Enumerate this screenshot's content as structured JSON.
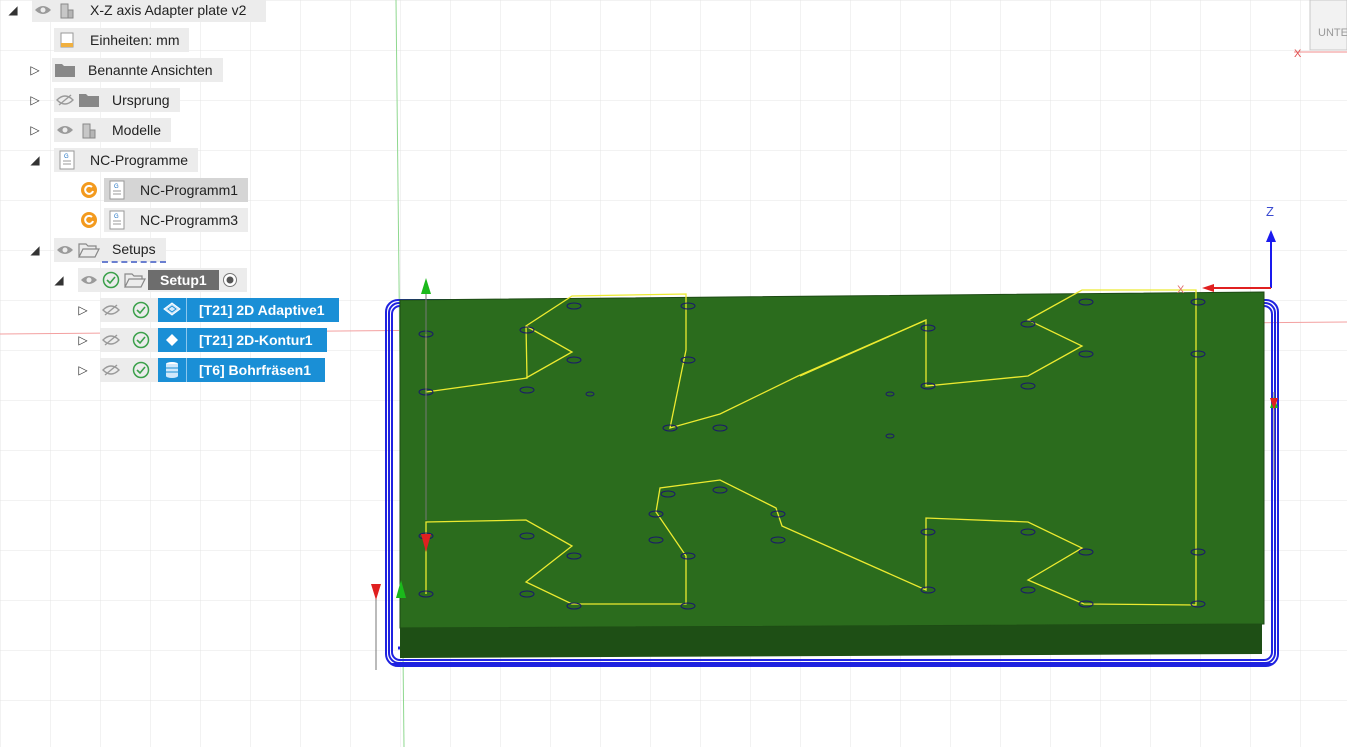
{
  "browser": {
    "root": {
      "label": "X-Z axis Adapter plate v2"
    },
    "units": {
      "label": "Einheiten: mm"
    },
    "named_views": {
      "label": "Benannte Ansichten"
    },
    "origin": {
      "label": "Ursprung"
    },
    "models": {
      "label": "Modelle"
    },
    "nc_programs": {
      "label": "NC-Programme",
      "items": [
        {
          "label": "NC-Programm1"
        },
        {
          "label": "NC-Programm3"
        }
      ]
    },
    "setups": {
      "label": "Setups",
      "setup1": {
        "label": "Setup1"
      },
      "operations": [
        {
          "label": "[T21] 2D Adaptive1"
        },
        {
          "label": "[T21] 2D-Kontur1"
        },
        {
          "label": "[T6] Bohrfräsen1"
        }
      ]
    }
  },
  "viewcube": {
    "label": "UNTE"
  },
  "axes": {
    "z": "Z",
    "x": "X"
  },
  "colors": {
    "stock_green": "#2a6b1c",
    "toolpath_blue": "#1f22e0",
    "toolpath_yellow": "#e8e62a",
    "selection_blue": "#1a8fd6",
    "orange_icon": "#f39a1e"
  }
}
